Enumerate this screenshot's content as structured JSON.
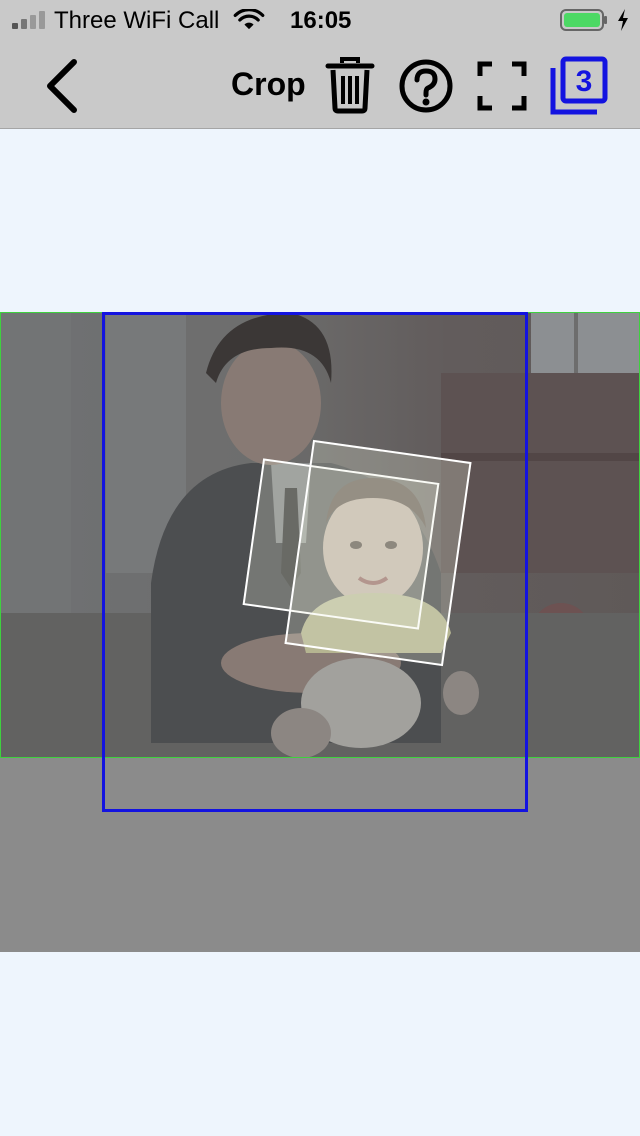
{
  "status_bar": {
    "carrier": "Three WiFi Call",
    "time": "16:05",
    "signal_bars": 4,
    "signal_icon": "signal-icon",
    "wifi_icon": "wifi-icon",
    "battery_icon": "battery-icon",
    "charging_icon": "lightning-icon",
    "battery_color": "#4cd964"
  },
  "nav_bar": {
    "title": "Crop",
    "back_icon": "chevron-left-icon",
    "actions": [
      {
        "name": "delete",
        "icon": "trash-icon"
      },
      {
        "name": "help",
        "icon": "question-circle-icon"
      },
      {
        "name": "fullscreen",
        "icon": "fullscreen-icon"
      },
      {
        "name": "layers",
        "icon": "layers-icon",
        "badge": "3",
        "color": "#1313e0"
      }
    ]
  },
  "editor": {
    "image_description": "photo-of-man-holding-child",
    "crop_box_color": "#1313e0",
    "image_bounds_color": "#3ed13e",
    "face_patch_color": "#ffffff",
    "face_patches": 2
  }
}
